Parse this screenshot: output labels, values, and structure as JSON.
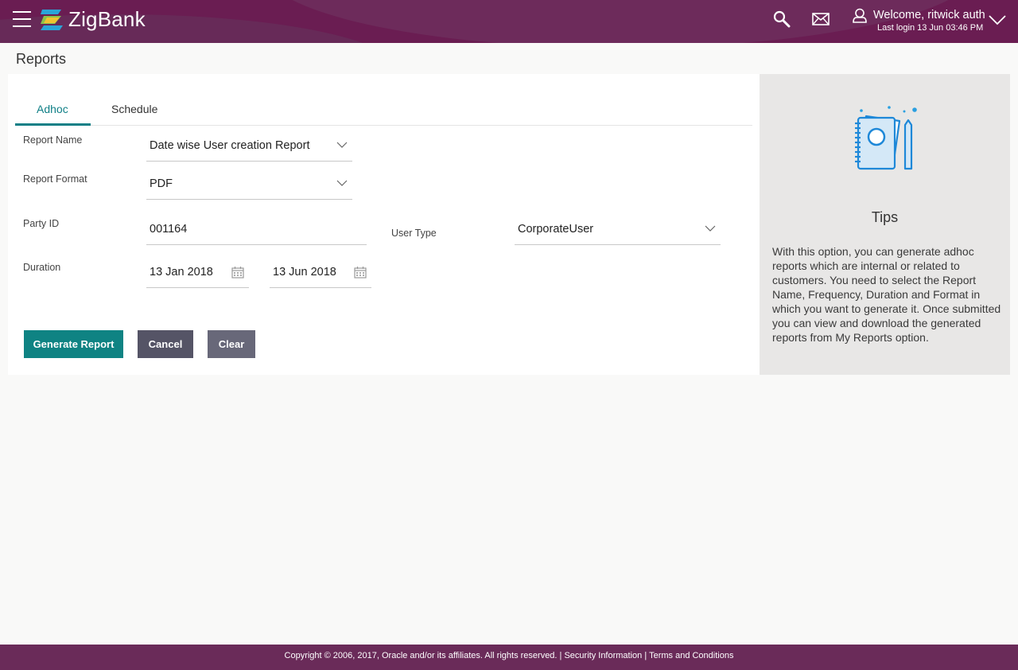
{
  "header": {
    "brand": "ZigBank",
    "welcome": "Welcome, ritwick auth",
    "last_login": "Last login 13 Jun 03:46 PM",
    "icons": [
      "menu-icon",
      "logo-icon",
      "search-icon",
      "mail-icon",
      "user-icon",
      "chevron-down-icon"
    ],
    "colors": {
      "header_bg": "#6a1d52",
      "accent": "#0f7f86"
    }
  },
  "page": {
    "title": "Reports"
  },
  "tabs": [
    {
      "label": "Adhoc",
      "active": true
    },
    {
      "label": "Schedule",
      "active": false
    }
  ],
  "form": {
    "report_name": {
      "label": "Report Name",
      "value": "Date wise User creation Report"
    },
    "report_format": {
      "label": "Report Format",
      "value": "PDF"
    },
    "party_id": {
      "label": "Party ID",
      "value": "001164"
    },
    "user_type": {
      "label": "User Type",
      "value": "CorporateUser"
    },
    "duration": {
      "label": "Duration",
      "from": "13 Jan 2018",
      "to": "13 Jun 2018"
    }
  },
  "buttons": {
    "generate": "Generate Report",
    "cancel": "Cancel",
    "clear": "Clear"
  },
  "tips": {
    "title": "Tips",
    "text": "With this option, you can generate adhoc reports which are internal or related to customers. You need to select the Report Name, Frequency, Duration and Format in which you want to generate it. Once submitted you can view and download the generated reports from My Reports option."
  },
  "footer": {
    "copyright": "Copyright © 2006, 2017, Oracle and/or its affiliates. All rights reserved. |",
    "security": "Security Information",
    "separator": "|",
    "terms": "Terms and Conditions"
  }
}
